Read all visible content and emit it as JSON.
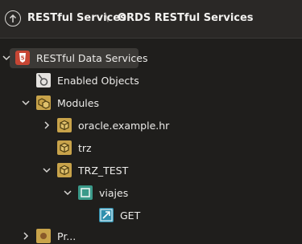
{
  "breadcrumb": {
    "items": [
      "RESTful Services",
      "ORDS RESTful Services"
    ],
    "separator": "\\"
  },
  "tree": {
    "root": "RESTful Data Services",
    "enabled_objects": "Enabled Objects",
    "modules": "Modules",
    "module_items": [
      "oracle.example.hr",
      "trz",
      "TRZ_TEST"
    ],
    "template": "viajes",
    "handler": "GET",
    "next_partial": "Pr..."
  },
  "colors": {
    "background": "#1f1e1c",
    "header": "#2a2826",
    "selected": "#3b3936",
    "root_icon": "#c74634",
    "module_icon": "#c8a34a",
    "template_icon": "#3b9a8a",
    "handler_icon": "#2f8fae"
  }
}
